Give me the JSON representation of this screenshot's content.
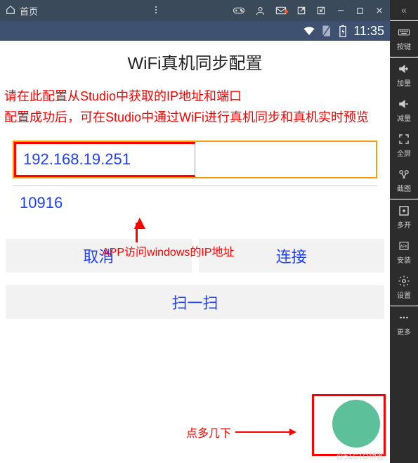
{
  "topbar": {
    "home_label": "首页"
  },
  "statusbar": {
    "time": "11:35"
  },
  "page": {
    "title": "WiFi真机同步配置",
    "instructions": "请在此配置从Studio中获取的IP地址和端口\n配置成功后，可在Studio中通过WiFi进行真机同步和真机实时预览",
    "ip_value": "192.168.19.251",
    "port_value": "10916",
    "cancel_label": "取消",
    "connect_label": "连接",
    "scan_label": "扫一扫"
  },
  "annotations": {
    "ip_hint": "APP访问windows的IP地址",
    "tap_hint": "点多几下"
  },
  "sidebar": {
    "items": [
      {
        "label": "按键",
        "icon": "keyboard"
      },
      {
        "label": "加量",
        "icon": "volup"
      },
      {
        "label": "减量",
        "icon": "voldown"
      },
      {
        "label": "全屏",
        "icon": "fullscreen"
      },
      {
        "label": "截图",
        "icon": "scissors"
      },
      {
        "label": "多开",
        "icon": "multi"
      },
      {
        "label": "安装",
        "icon": "apk"
      },
      {
        "label": "设置",
        "icon": "gear"
      },
      {
        "label": "更多",
        "icon": "dots"
      }
    ]
  },
  "watermark": "@51CTO博客"
}
